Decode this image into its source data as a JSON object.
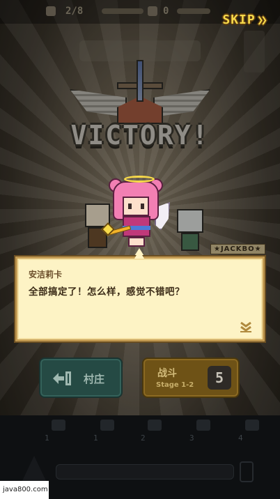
{
  "hud": {
    "stamina": "2/8",
    "coins": "0"
  },
  "skip": {
    "label": "SKIP",
    "arrows": "❯❯"
  },
  "result": {
    "title": "VICTORY!"
  },
  "party": {
    "tag": "★JACKBO★"
  },
  "dialog": {
    "speaker": "安洁莉卡",
    "text": "全部搞定了！怎么样，感觉不错吧？",
    "next_icon": "double-chevron-down-icon"
  },
  "buttons": {
    "village": {
      "label": "村庄",
      "icon": "exit-door-icon"
    },
    "battle": {
      "label": "战斗",
      "stage": "Stage 1-2",
      "count": "5"
    }
  },
  "slots": [
    {
      "level": "1"
    },
    {
      "level": "1"
    },
    {
      "level": "2"
    },
    {
      "level": "3"
    },
    {
      "level": "4"
    }
  ],
  "watermark": "java800.com",
  "colors": {
    "dialog_bg": "#fdf3c5",
    "dialog_border": "#c29a52",
    "skip": "#f7d94a",
    "village_button": "#254a44",
    "battle_button": "#6e5216"
  }
}
